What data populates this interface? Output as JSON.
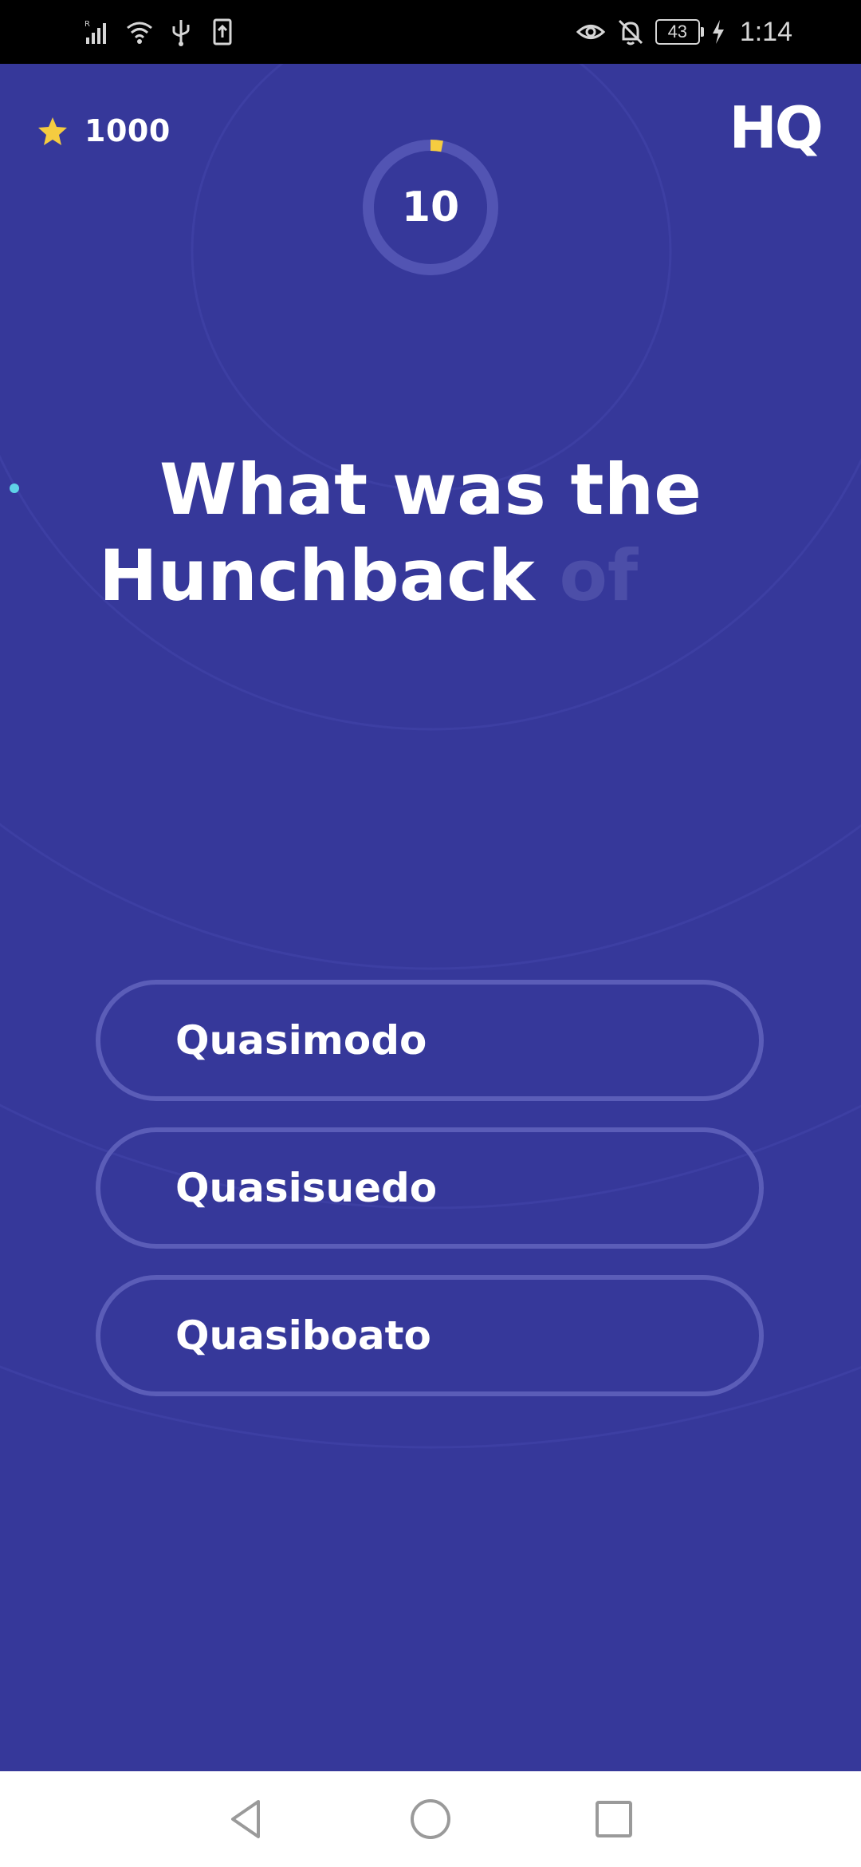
{
  "status_bar": {
    "time": "1:14",
    "battery_level": "43",
    "left_icons": [
      "signal-icon",
      "wifi-icon",
      "usb-icon",
      "upload-icon"
    ],
    "right_icons": [
      "eye-icon",
      "bell-off-icon",
      "battery-icon",
      "charging-icon"
    ]
  },
  "header": {
    "score": "1000",
    "score_icon": "star-icon",
    "logo": "HQ"
  },
  "timer": {
    "value": "10",
    "progress_fraction": 0.03,
    "track_color": "#5254b3",
    "progress_color": "#f5cc40"
  },
  "question": {
    "line1": "What was the",
    "line2": "Hunchback",
    "line2_faded": "of"
  },
  "answers": [
    {
      "label": "Quasimodo"
    },
    {
      "label": "Quasisuedo"
    },
    {
      "label": "Quasiboato"
    }
  ],
  "colors": {
    "background": "#36389a",
    "answer_border": "#5b5db8",
    "accent_star": "#f5cc40",
    "dot": "#5fd3e8"
  },
  "nav_bar": {
    "buttons": [
      "back-icon",
      "home-icon",
      "recents-icon"
    ]
  }
}
